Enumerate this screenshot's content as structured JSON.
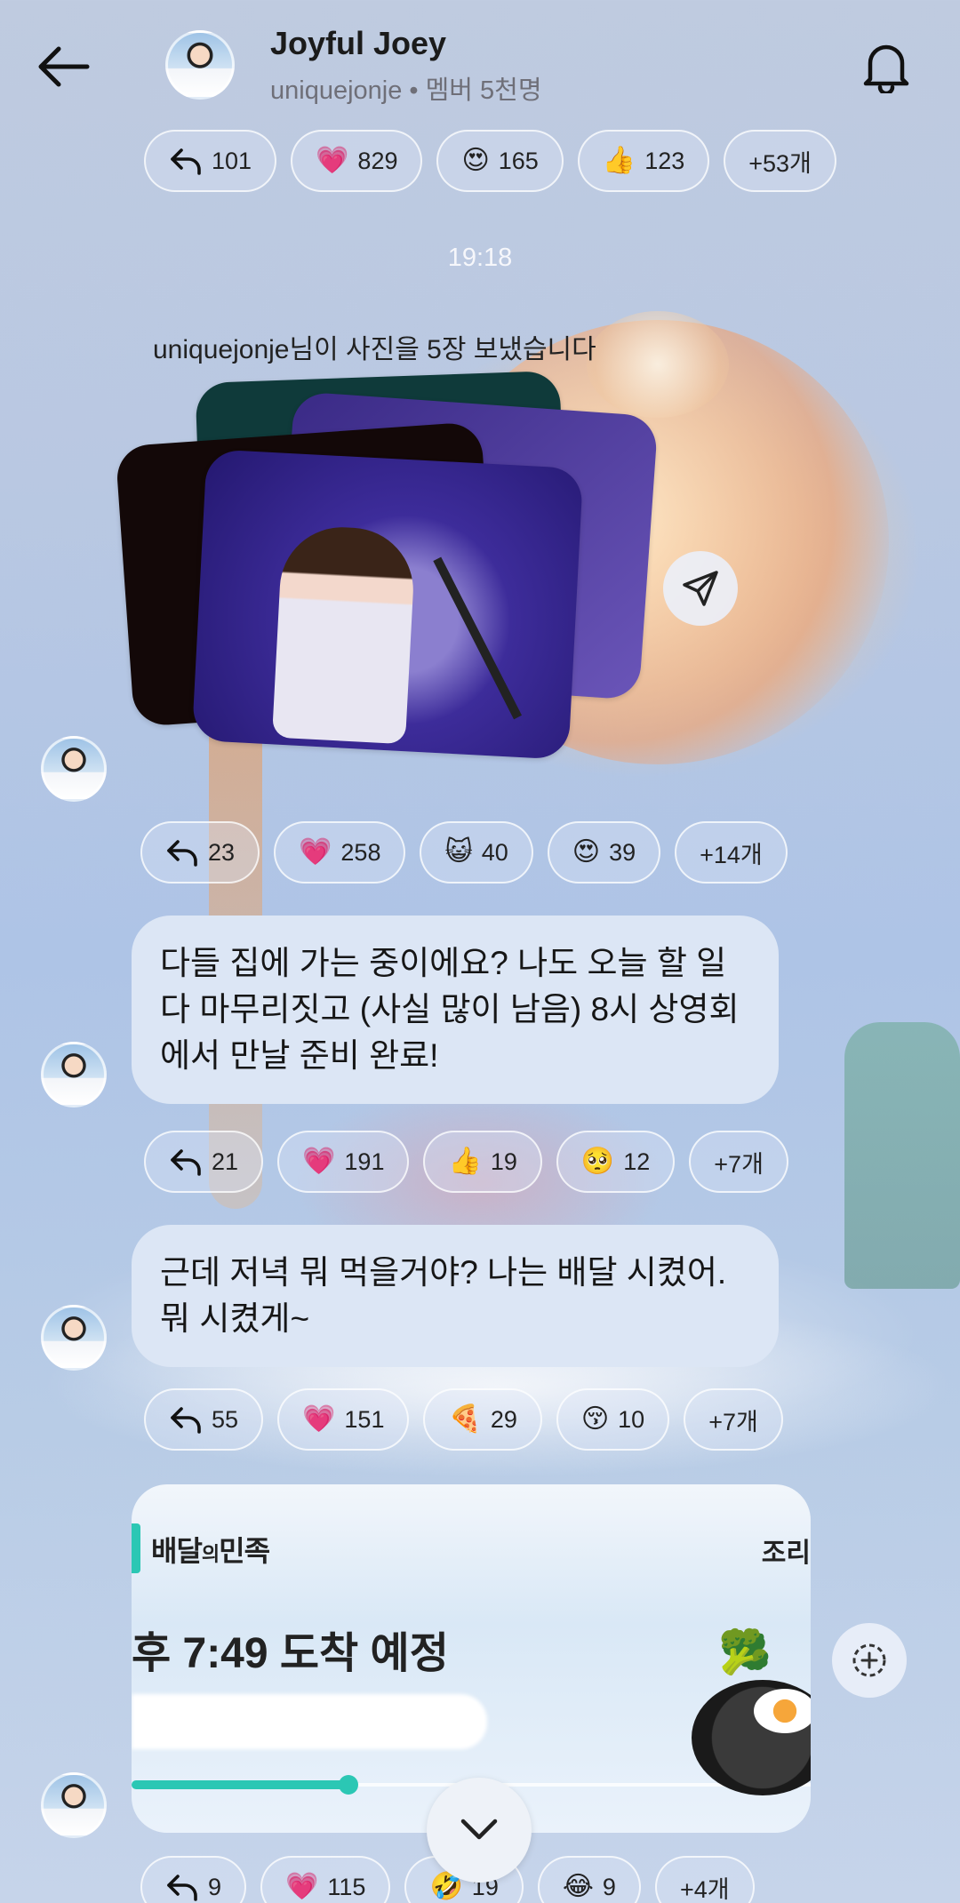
{
  "header": {
    "title": "Joyful Joey",
    "subtitle": "uniquejonje • 멤버 5천명"
  },
  "reactions_1": [
    {
      "icon": "reply-icon",
      "emoji": "",
      "count": "101"
    },
    {
      "icon": "heart-emoji",
      "emoji": "💗",
      "count": "829"
    },
    {
      "icon": "heart-eyes-emoji",
      "emoji": "😍",
      "count": "165"
    },
    {
      "icon": "thumbs-up-emoji",
      "emoji": "👍",
      "count": "123"
    },
    {
      "icon": "",
      "emoji": "",
      "count": "+53개"
    }
  ],
  "timestamp": "19:18",
  "system_message": "uniquejonje님이 사진을 5장 보냈습니다",
  "reactions_2": [
    {
      "icon": "reply-icon",
      "emoji": "",
      "count": "23"
    },
    {
      "icon": "heart-emoji",
      "emoji": "💗",
      "count": "258"
    },
    {
      "icon": "cat-emoji",
      "emoji": "😺",
      "count": "40"
    },
    {
      "icon": "heart-eyes-emoji",
      "emoji": "😍",
      "count": "39"
    },
    {
      "icon": "",
      "emoji": "",
      "count": "+14개"
    }
  ],
  "messages": [
    {
      "text": "다들 집에 가는 중이에요? 나도 오늘 할 일 다 마무리짓고 (사실 많이 남음) 8시 상영회에서 만날 준비 완료!"
    },
    {
      "text": "근데 저녁 뭐 먹을거야? 나는 배달 시켰어. 뭐 시켰게~"
    }
  ],
  "reactions_3": [
    {
      "icon": "reply-icon",
      "emoji": "",
      "count": "21"
    },
    {
      "icon": "heart-emoji",
      "emoji": "💗",
      "count": "191"
    },
    {
      "icon": "thumbs-up-emoji",
      "emoji": "👍",
      "count": "19"
    },
    {
      "icon": "pleading-emoji",
      "emoji": "🥺",
      "count": "12"
    },
    {
      "icon": "",
      "emoji": "",
      "count": "+7개"
    }
  ],
  "reactions_4": [
    {
      "icon": "reply-icon",
      "emoji": "",
      "count": "55"
    },
    {
      "icon": "heart-emoji",
      "emoji": "💗",
      "count": "151"
    },
    {
      "icon": "pizza-emoji",
      "emoji": "🍕",
      "count": "29"
    },
    {
      "icon": "kissing-emoji",
      "emoji": "😚",
      "count": "10"
    },
    {
      "icon": "",
      "emoji": "",
      "count": "+7개"
    }
  ],
  "delivery": {
    "brand": "배달의민족",
    "brand_small": "의",
    "brand_pre": "배달",
    "brand_post": "민족",
    "corner": "조리",
    "eta": "후 7:49 도착 예정",
    "progress": 0.32
  },
  "reactions_5": [
    {
      "icon": "reply-icon",
      "emoji": "",
      "count": "9"
    },
    {
      "icon": "heart-emoji",
      "emoji": "💗",
      "count": "115"
    },
    {
      "icon": "rofl-emoji",
      "emoji": "🤣",
      "count": "19"
    },
    {
      "icon": "joy-emoji",
      "emoji": "😂",
      "count": "9"
    },
    {
      "icon": "",
      "emoji": "",
      "count": "+4개"
    }
  ]
}
